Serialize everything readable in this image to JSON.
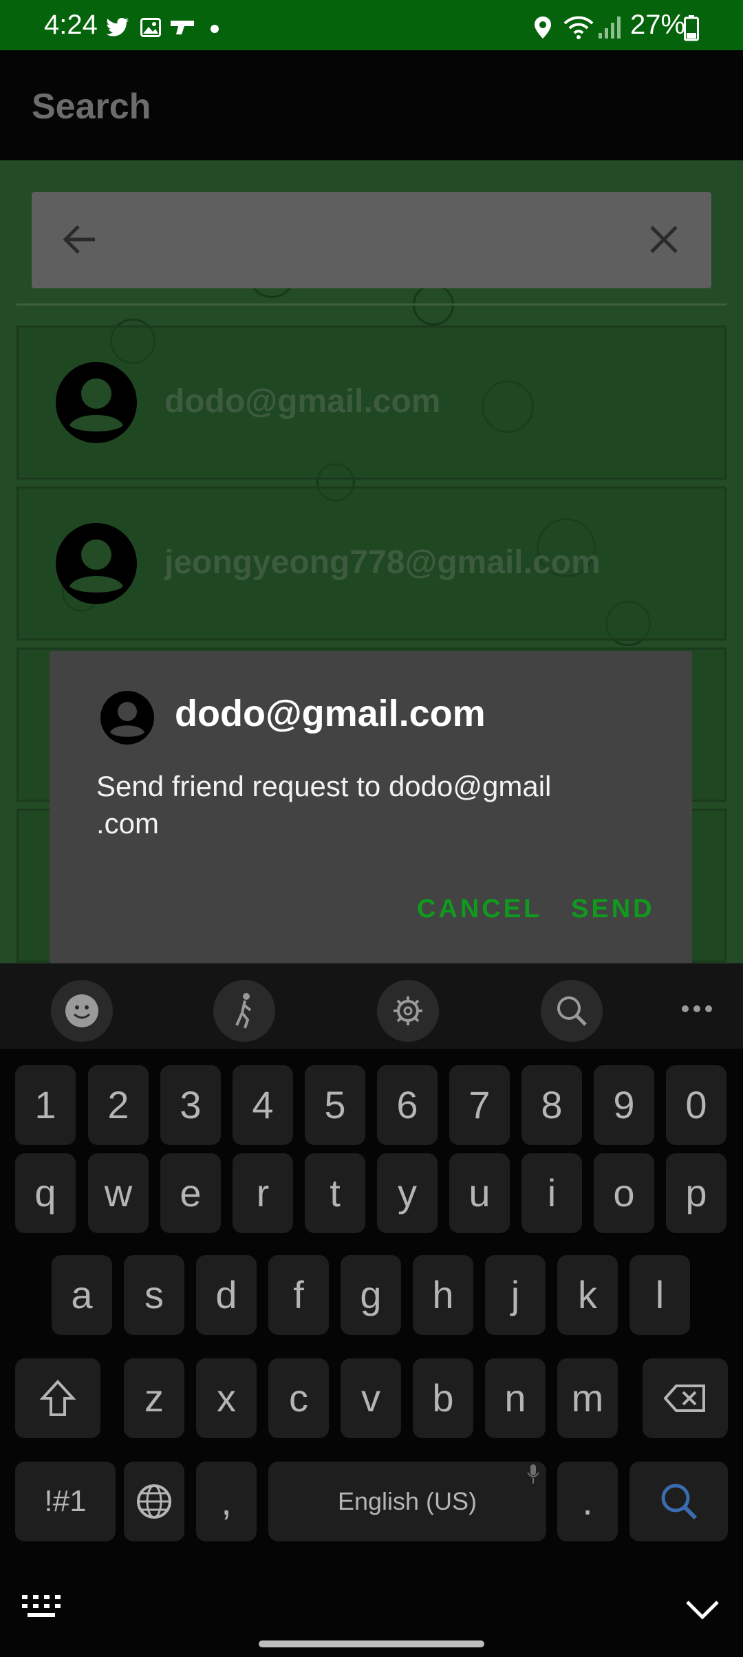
{
  "status_bar": {
    "time": "4:24",
    "battery": "27%"
  },
  "app_bar": {
    "title": "Search"
  },
  "search": {
    "value": "",
    "placeholder": ""
  },
  "results": [
    {
      "email": "dodo@gmail.com"
    },
    {
      "email": "jeongyeong778@gmail.com"
    }
  ],
  "dialog": {
    "title": "dodo@gmail.com",
    "message": "Send friend request to dodo@gmail .com",
    "cancel": "CANCEL",
    "send": "SEND"
  },
  "keyboard": {
    "numbers": [
      "1",
      "2",
      "3",
      "4",
      "5",
      "6",
      "7",
      "8",
      "9",
      "0"
    ],
    "row1": [
      "q",
      "w",
      "e",
      "r",
      "t",
      "y",
      "u",
      "i",
      "o",
      "p"
    ],
    "row2": [
      "a",
      "s",
      "d",
      "f",
      "g",
      "h",
      "j",
      "k",
      "l"
    ],
    "row3": [
      "z",
      "x",
      "c",
      "v",
      "b",
      "n",
      "m"
    ],
    "symbols": "!#1",
    "comma": ",",
    "space": "English (US)",
    "period": "."
  },
  "colors": {
    "status_bar": "#05630b",
    "accent": "#0f9a1e",
    "dialog": "#434343"
  }
}
